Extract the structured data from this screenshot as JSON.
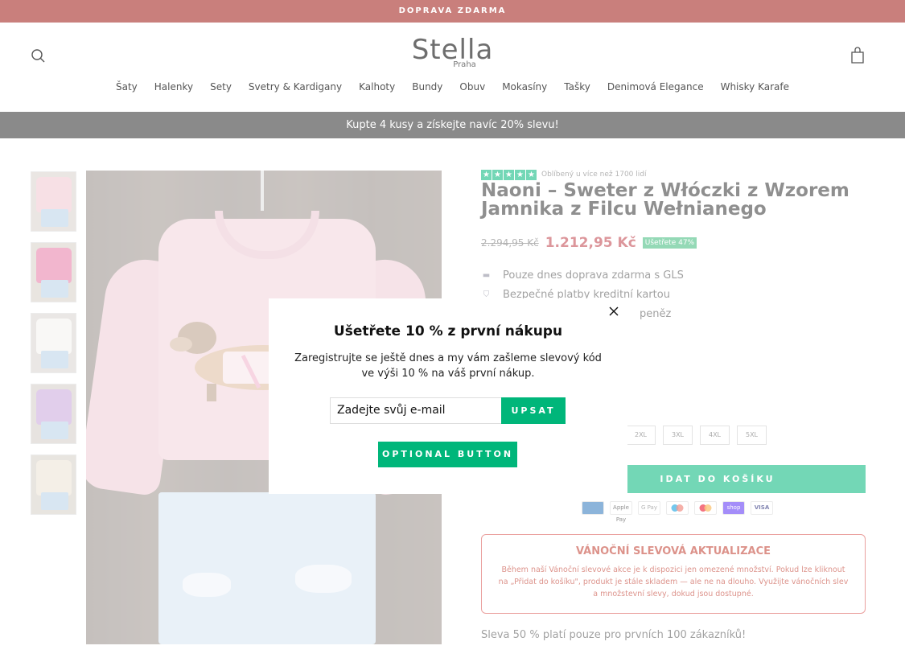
{
  "announcement": "DOPRAVA ZDARMA",
  "logo": {
    "main": "Stella",
    "sub": "Praha"
  },
  "nav": [
    "Šaty",
    "Halenky",
    "Sety",
    "Svetry & Kardigany",
    "Kalhoty",
    "Bundy",
    "Obuv",
    "Mokasíny",
    "Tašky",
    "Denimová Elegance",
    "Whisky Karafe"
  ],
  "promo_bar": "Kupte 4 kusy a získejte navíc 20% slevu!",
  "product": {
    "rating_text": "Oblíbený u více než 1700 lidí",
    "stars": 5,
    "title": "Naoni – Sweter z Włóczki z Wzorem Jamnika z Filcu Wełnianego",
    "old_price": "2.294,95 Kč",
    "new_price": "1.212,95 Kč",
    "save_badge": "Ušetřete 47%",
    "features": [
      {
        "icon": "truck-icon",
        "text": "Pouze dnes doprava zdarma s GLS"
      },
      {
        "icon": "shield-icon",
        "text": "Bezpečné platby kreditní kartou"
      },
      {
        "icon": "money-icon",
        "text": "peněz"
      }
    ],
    "sizes": [
      "2XL",
      "3XL",
      "4XL",
      "5XL"
    ],
    "add_to_cart": "IDAT DO KOŠÍKU",
    "payments": [
      "AMEX",
      "Apple Pay",
      "G Pay",
      "Maestro",
      "Mastercard",
      "shop",
      "VISA"
    ],
    "xmas_title": "VÁNOČNÍ SLEVOVÁ AKTUALIZACE",
    "xmas_text": "Během naší Vánoční slevové akce je k dispozici jen omezené množství. Pokud lze kliknout na „Přidat do košíku\", produkt je stále skladem — ale ne na dlouho. Využijte vánočních slev a množstevní slevy, dokud jsou dostupné.",
    "limit_text": "Sleva 50 % platí pouze pro prvních 100 zákazníků!"
  },
  "modal": {
    "title": "Ušetřete 10 % z první nákupu",
    "text": "Zaregistrujte se ještě dnes a my vám zašleme slevový kód ve výši 10 % na váš první nákup.",
    "email_placeholder": "Zadejte svůj e-mail",
    "submit_label": "UPSAT",
    "optional_label": "OPTIONAL BUTTON"
  },
  "colors": {
    "accent": "#00b67a",
    "announce_bg": "#c97f7c",
    "price": "#c0404a",
    "xmas": "#c0392b"
  }
}
